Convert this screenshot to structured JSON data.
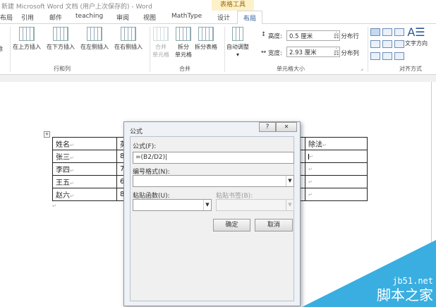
{
  "title": "新建 Microsoft Word 文档 (用户上次保存的) - Word",
  "tool_tab": "表格工具",
  "tabs": [
    "布局",
    "引用",
    "邮件",
    "teaching",
    "审阅",
    "视图",
    "MathType",
    "设计",
    "布局"
  ],
  "ribbon": {
    "delete": "除",
    "insert_above": "在上方插入",
    "insert_below": "在下方插入",
    "insert_left": "在左侧插入",
    "insert_right": "在右侧插入",
    "group_rows": "行和列",
    "merge_cells": [
      "合并",
      "单元格"
    ],
    "split_cells": [
      "拆分",
      "单元格"
    ],
    "split_table": "拆分表格",
    "group_merge": "合并",
    "autofit": "自动调整",
    "height_label": "高度:",
    "height_value": "0.5 厘米",
    "width_label": "宽度:",
    "width_value": "2.93 厘米",
    "dist_rows": "分布行",
    "dist_cols": "分布列",
    "group_cellsize": "单元格大小",
    "text_direction": "文字方向",
    "group_align": "对齐方式"
  },
  "table": {
    "header": [
      "姓名",
      "英",
      "除法"
    ],
    "rows": [
      [
        "张三",
        "87",
        ""
      ],
      [
        "李四",
        "76",
        ""
      ],
      [
        "王五",
        "65",
        ""
      ],
      [
        "赵六",
        "87",
        ""
      ]
    ]
  },
  "dialog": {
    "title": "公式",
    "help": "?",
    "close": "✕",
    "formula_label": "公式(F):",
    "formula_value": "=(B2/D2)",
    "format_label": "编号格式(N):",
    "format_value": "",
    "paste_function_label": "粘贴函数(U):",
    "paste_bookmark_label": "粘贴书签(B):",
    "ok": "确定",
    "cancel": "取消"
  },
  "watermark": {
    "line1": "jb51.net",
    "line2": "脚本之家"
  }
}
